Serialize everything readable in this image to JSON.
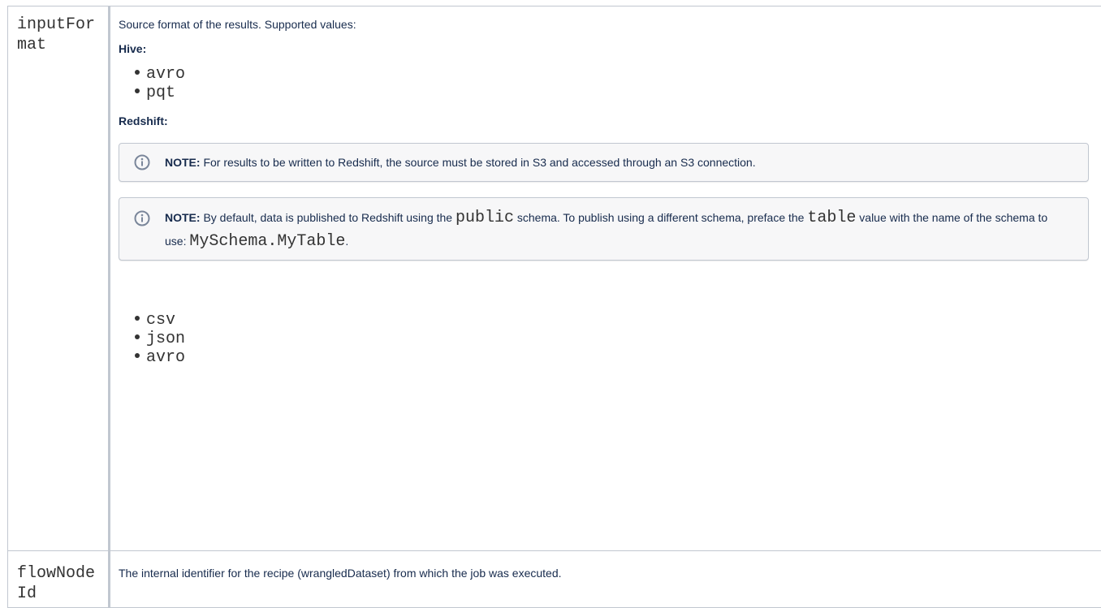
{
  "rows": [
    {
      "param": "inputFormat",
      "description": "Source format of the results. Supported values:",
      "hive": {
        "heading": "Hive:",
        "items": [
          "avro",
          "pqt"
        ]
      },
      "redshift": {
        "heading": "Redshift:",
        "note1": {
          "label": "NOTE:",
          "text": " For results to be written to Redshift, the source must be stored in S3 and accessed through an S3 connection."
        },
        "note2": {
          "label": "NOTE:",
          "text_a": " By default, data is published to Redshift using the ",
          "code_a": "public",
          "text_b": " schema. To publish using a different schema, preface the ",
          "code_b": "table",
          "text_c": " value with the name of the schema to use: ",
          "code_c": "MySchema.MyTable",
          "text_d": "."
        },
        "items": [
          "csv",
          "json",
          "avro"
        ]
      }
    },
    {
      "param": "flowNodeId",
      "description": "The internal identifier for the recipe (wrangledDataset) from which the job was executed."
    }
  ],
  "colors": {
    "border": "#c1c7d0",
    "note_bg": "#f7f7f8",
    "info_icon": "#7a869a"
  },
  "icons": {
    "note": "info-icon"
  }
}
